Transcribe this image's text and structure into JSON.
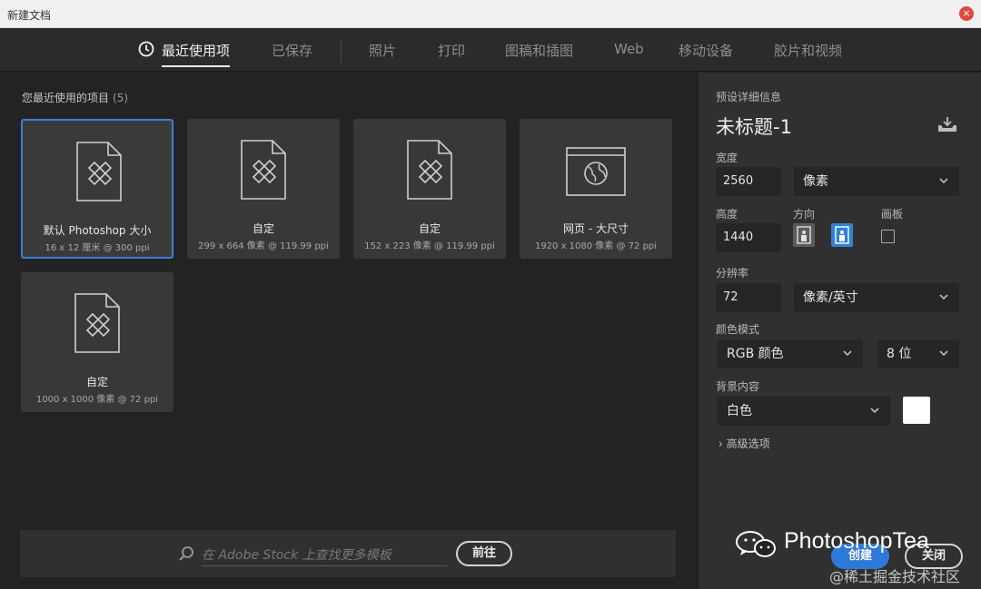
{
  "window": {
    "title": "新建文档",
    "close_glyph": "×"
  },
  "tabs": [
    {
      "label": "最近使用项",
      "active": true
    },
    {
      "label": "已保存"
    },
    {
      "label": "照片"
    },
    {
      "label": "打印"
    },
    {
      "label": "图稿和插图"
    },
    {
      "label": "Web"
    },
    {
      "label": "移动设备"
    },
    {
      "label": "胶片和视频"
    }
  ],
  "recent": {
    "label": "您最近使用的项目",
    "count": "(5)",
    "items": [
      {
        "name": "默认 Photoshop 大小",
        "meta": "16 x 12 厘米 @ 300 ppi",
        "icon": "document-icon",
        "selected": true
      },
      {
        "name": "自定",
        "meta": "299 x 664 像素 @ 119.99 ppi",
        "icon": "document-icon"
      },
      {
        "name": "自定",
        "meta": "152 x 223 像素 @ 119.99 ppi",
        "icon": "document-icon"
      },
      {
        "name": "网页 - 大尺寸",
        "meta": "1920 x 1080 像素 @ 72 ppi",
        "icon": "web-document-icon"
      },
      {
        "name": "自定",
        "meta": "1000 x 1000 像素 @ 72 ppi",
        "icon": "document-icon"
      }
    ]
  },
  "stock": {
    "placeholder": "在 Adobe Stock 上查找更多模板",
    "go_label": "前往"
  },
  "preset": {
    "section_label": "预设详细信息",
    "doc_name": "未标题-1",
    "width_label": "宽度",
    "width_value": "2560",
    "width_unit": "像素",
    "height_label": "高度",
    "height_value": "1440",
    "orientation_label": "方向",
    "artboard_label": "画板",
    "resolution_label": "分辨率",
    "resolution_value": "72",
    "resolution_unit": "像素/英寸",
    "color_mode_label": "颜色模式",
    "color_mode": "RGB 颜色",
    "bit_depth": "8 位",
    "background_label": "背景内容",
    "background": "白色",
    "background_color": "#ffffff",
    "advanced_label": "高级选项"
  },
  "actions": {
    "create": "创建",
    "close": "关闭"
  },
  "watermark": {
    "brand": "PhotoshopTea",
    "sub": "@稀土掘金技术社区"
  },
  "colors": {
    "accent": "#2e79d8",
    "selected_border": "#3d7fd9",
    "panel_bg": "#303030",
    "main_bg": "#232323"
  }
}
